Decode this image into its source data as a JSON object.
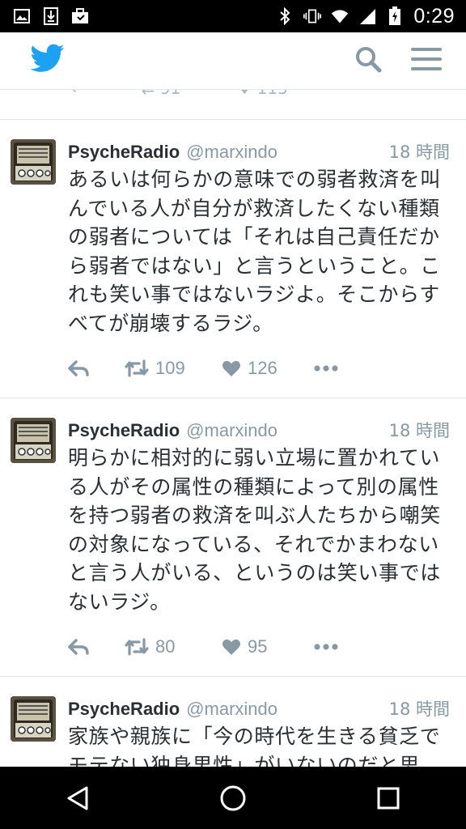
{
  "status_bar": {
    "time": "0:29",
    "icons": [
      "image-icon",
      "download-icon",
      "briefcase-icon",
      "bluetooth-icon",
      "vibrate-icon",
      "wifi-icon",
      "signal-icon",
      "battery-charging-icon"
    ]
  },
  "header": {
    "logo": "twitter-bird-icon",
    "actions": [
      "search-icon",
      "menu-icon"
    ]
  },
  "tweets": [
    {
      "name": "PsycheRadio",
      "handle": "@marxindo",
      "time": "18 時間",
      "text": "あるいは何らかの意味での弱者救済を叫んでいる人が自分が救済したくない種類の弱者については「それは自己責任だから弱者ではない」と言うということ。これも笑い事ではないラジよ。そこからすべてが崩壊するラジ。",
      "retweets": "109",
      "likes": "126"
    },
    {
      "name": "PsycheRadio",
      "handle": "@marxindo",
      "time": "18 時間",
      "text": "明らかに相対的に弱い立場に置かれている人がその属性の種類によって別の属性を持つ弱者の救済を叫ぶ人たちから嘲笑の対象になっている、それでかまわないと言う人がいる、というのは笑い事ではないラジ。",
      "retweets": "80",
      "likes": "95"
    },
    {
      "name": "PsycheRadio",
      "handle": "@marxindo",
      "time": "18 時間",
      "text": "家族や親族に「今の時代を生きる貧乏でモテない独身男性」がいないのだと思う。いたら絶対に笑えないラジよ。",
      "retweets": "",
      "likes": ""
    }
  ],
  "colors": {
    "brand": "#1da1f2",
    "icon_gray": "#8899a6",
    "text": "#292f33",
    "divider": "#e1e8ed"
  },
  "nav_bar": {
    "buttons": [
      "back-icon",
      "home-icon",
      "recents-icon"
    ]
  }
}
